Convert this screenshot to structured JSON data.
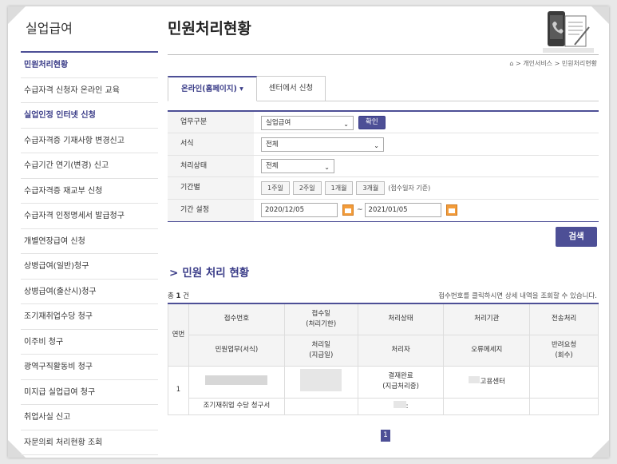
{
  "sidebar": {
    "title": "실업급여",
    "items": [
      {
        "label": "민원처리현황",
        "active": true
      },
      {
        "label": "수급자격 신청자 온라인 교육",
        "active": false
      },
      {
        "label": "실업인정 인터넷 신청",
        "active": true
      },
      {
        "label": "수급자격증 기재사항 변경신고",
        "active": false
      },
      {
        "label": "수급기간 연기(변경) 신고",
        "active": false
      },
      {
        "label": "수급자격증 재교부 신청",
        "active": false
      },
      {
        "label": "수급자격 인정명세서 발급청구",
        "active": false
      },
      {
        "label": "개별연장급여 신청",
        "active": false
      },
      {
        "label": "상병급여(일반)청구",
        "active": false
      },
      {
        "label": "상병급여(출산시)청구",
        "active": false
      },
      {
        "label": "조기재취업수당 청구",
        "active": false
      },
      {
        "label": "이주비 청구",
        "active": false
      },
      {
        "label": "광역구직활동비 청구",
        "active": false
      },
      {
        "label": "미지급 실업급여 청구",
        "active": false
      },
      {
        "label": "취업사실 신고",
        "active": false
      },
      {
        "label": "자문의뢰 처리현황 조회",
        "active": false
      }
    ]
  },
  "header": {
    "title": "민원처리현황",
    "breadcrumb": "> 개인서비스 > 민원처리현황",
    "home_icon": "home-icon"
  },
  "tabs": [
    {
      "label": "온라인(홈페이지) ▾",
      "active": true
    },
    {
      "label": "센터에서 신청",
      "active": false
    }
  ],
  "form": {
    "business_type": {
      "label": "업무구분",
      "value": "실업급여",
      "confirm": "확인"
    },
    "form_type": {
      "label": "서식",
      "value": "전체"
    },
    "status": {
      "label": "처리상태",
      "value": "전체"
    },
    "period": {
      "label": "기간별",
      "buttons": [
        "1주일",
        "2주일",
        "1개월",
        "3개월"
      ],
      "hint": "(접수일자 기준)"
    },
    "range": {
      "label": "기간 설정",
      "from": "2020/12/05",
      "to": "2021/01/05",
      "separator": "~"
    }
  },
  "search_button": "검색",
  "results": {
    "section_title": "민원 처리 현황",
    "count_prefix": "총",
    "count": "1",
    "count_suffix": "건",
    "note": "접수번호를 클릭하시면 상세 내역을 조회할 수 있습니다.",
    "headers_top": [
      "연번",
      "접수번호",
      "접수일\n(처리기한)",
      "처리상태",
      "처리기관",
      "전송처리"
    ],
    "headers_bottom": [
      "민원업무(서식)",
      "처리일\n(지급일)",
      "처리자",
      "오류메세지",
      "반려요청\n(회수)"
    ],
    "rows": [
      {
        "index": "1",
        "status": "결재완료\n(지급처리중)",
        "agency_suffix": "고용센터",
        "form_name": "조기재취업 수당 청구서",
        "processor_tail": ":"
      }
    ],
    "page": "1"
  },
  "colors": {
    "accent": "#4d4f96",
    "accent_dark": "#3a3c88",
    "calendar": "#f39c3a"
  }
}
